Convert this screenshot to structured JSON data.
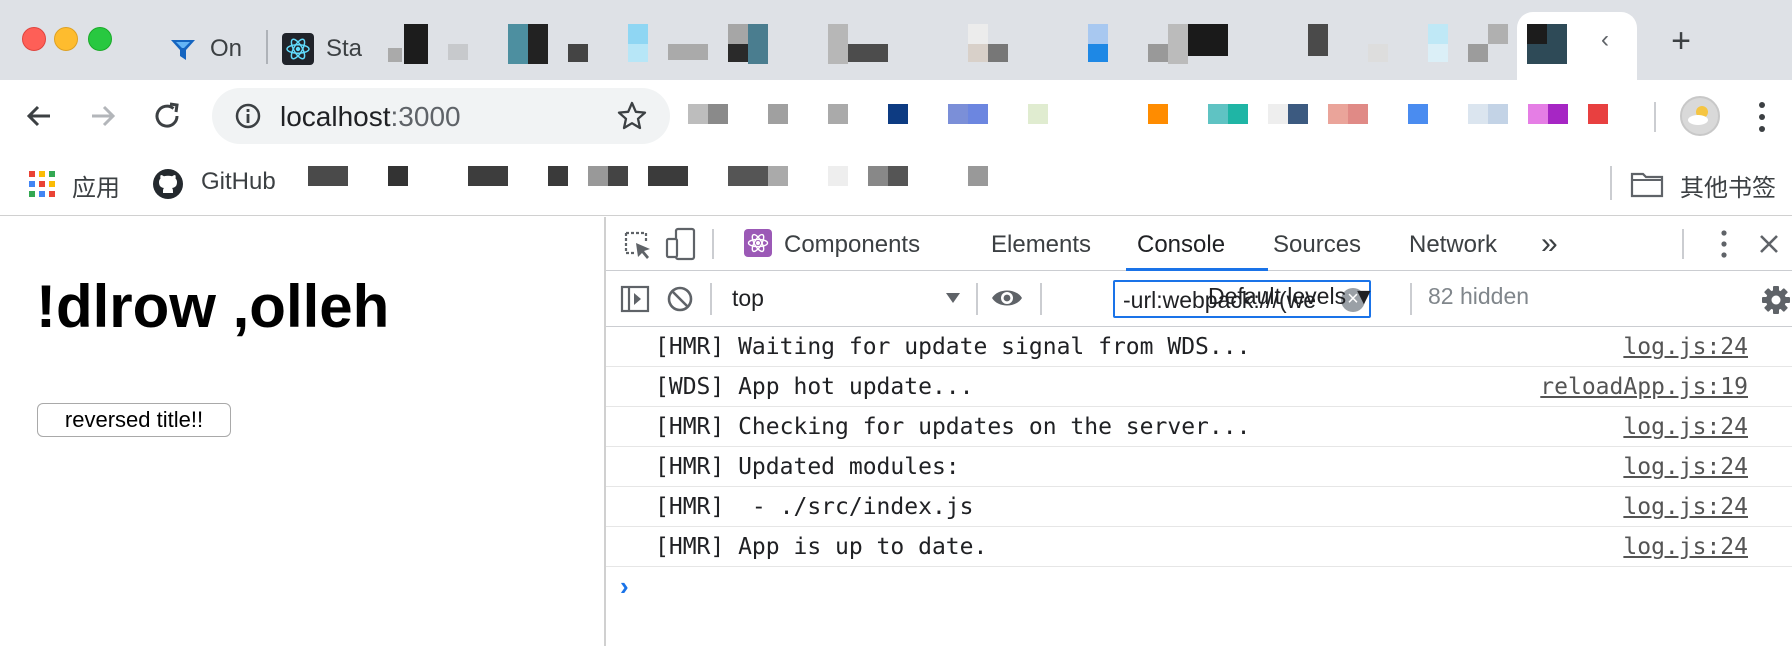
{
  "browser": {
    "tabs": [
      {
        "title": "On",
        "icon": "funnel-icon",
        "color": "#1565c0"
      },
      {
        "title": "Sta",
        "icon": "react-icon",
        "color": "#61dafb"
      }
    ],
    "new_tab_symbol": "+"
  },
  "toolbar": {
    "url_host": "localhost",
    "url_port": ":3000"
  },
  "bookmarks": {
    "apps_label": "应用",
    "github_label": "GitHub",
    "other_label": "其他书签"
  },
  "page": {
    "heading": "!dlrow ,olleh",
    "button_label": "reversed title!!"
  },
  "devtools": {
    "tabs": [
      {
        "label": "Components",
        "active": false
      },
      {
        "label": "Elements",
        "active": false
      },
      {
        "label": "Console",
        "active": true
      },
      {
        "label": "Sources",
        "active": false
      },
      {
        "label": "Network",
        "active": false
      }
    ],
    "more_tabs": "»",
    "accent": "#1a73e8",
    "console": {
      "context": "top",
      "filter": "-url:webpack:///(we",
      "levels": "Default levels ▼",
      "hidden": "82 hidden"
    },
    "log": [
      {
        "message": "[HMR] Waiting for update signal from WDS...",
        "source": "log.js:24"
      },
      {
        "message": "[WDS] App hot update...",
        "source": "reloadApp.js:19"
      },
      {
        "message": "[HMR] Checking for updates on the server...",
        "source": "log.js:24"
      },
      {
        "message": "[HMR] Updated modules:",
        "source": "log.js:24"
      },
      {
        "message": "[HMR]  - ./src/index.js",
        "source": "log.js:24"
      },
      {
        "message": "[HMR] App is up to date.",
        "source": "log.js:24"
      }
    ],
    "prompt": "›"
  }
}
